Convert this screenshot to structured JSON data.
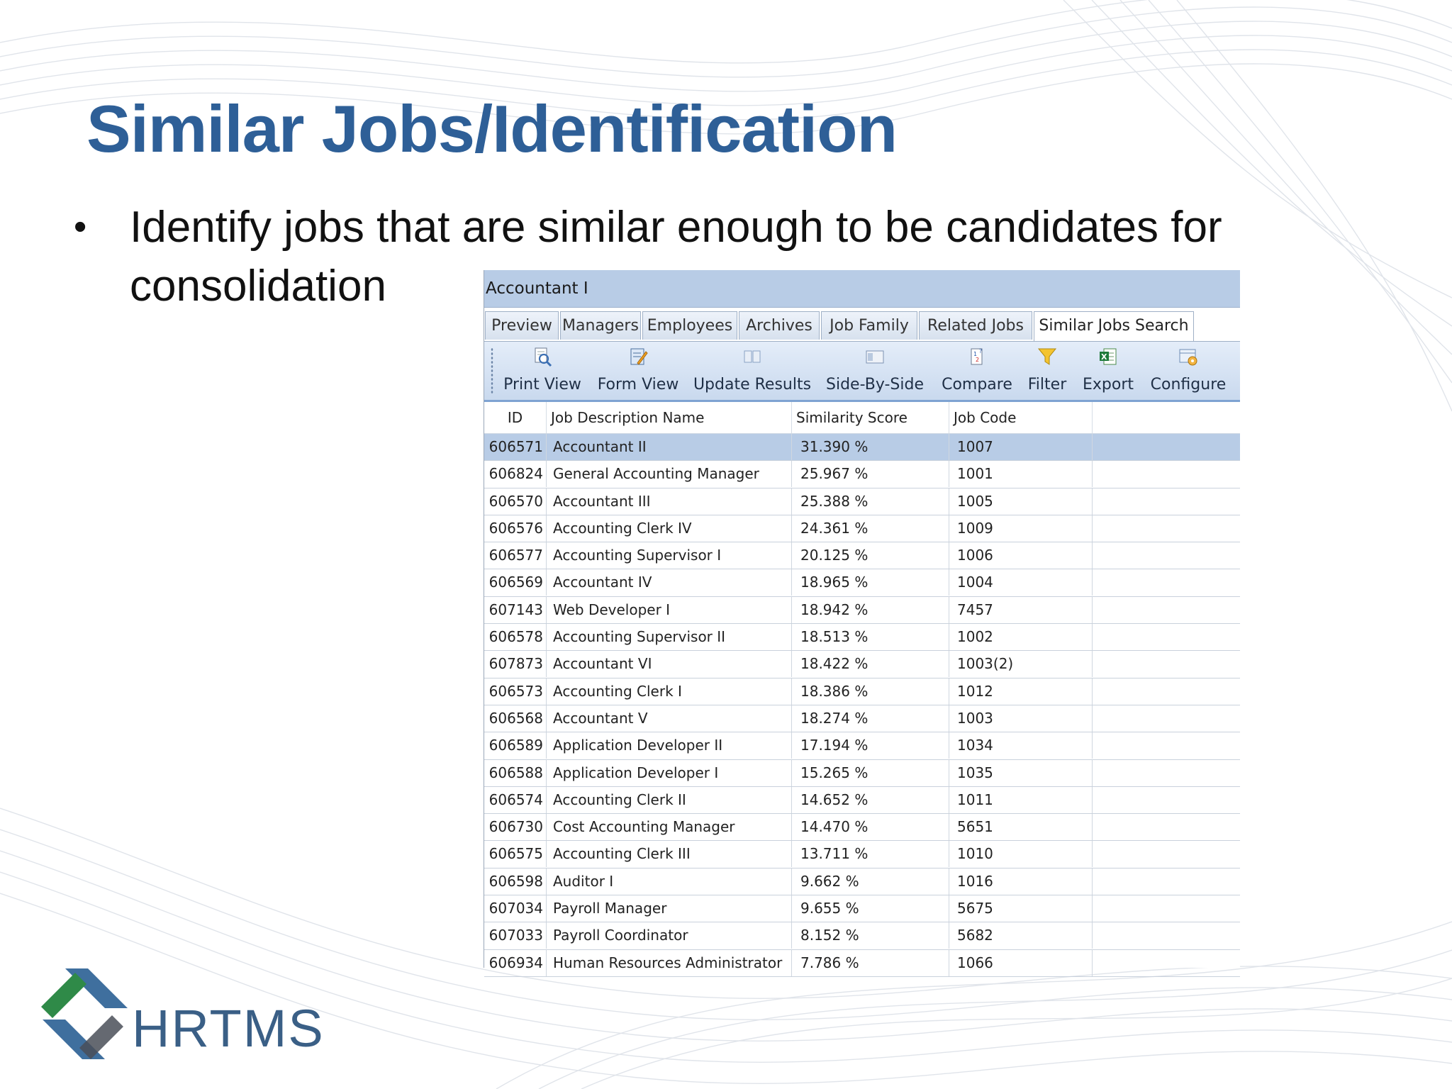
{
  "slide": {
    "title": "Similar Jobs/Identification",
    "bullet_line1": "Identify jobs that are similar enough to be candidates for",
    "bullet_line2": "consolidation",
    "logo_text": "HRTMS"
  },
  "app": {
    "header_title": "Accountant I",
    "tabs": [
      {
        "label": "Preview"
      },
      {
        "label": "Managers"
      },
      {
        "label": "Employees"
      },
      {
        "label": "Archives"
      },
      {
        "label": "Job Family"
      },
      {
        "label": "Related Jobs"
      },
      {
        "label": "Similar Jobs Search",
        "active": true
      }
    ],
    "toolbar": [
      {
        "label": "Print View",
        "icon": "print-view-icon"
      },
      {
        "label": "Form View",
        "icon": "form-view-icon"
      },
      {
        "label": "Update Results",
        "icon": "update-results-icon"
      },
      {
        "label": "Side-By-Side",
        "icon": "side-by-side-icon"
      },
      {
        "label": "Compare",
        "icon": "compare-icon"
      },
      {
        "label": "Filter",
        "icon": "filter-icon"
      },
      {
        "label": "Export",
        "icon": "excel-export-icon"
      },
      {
        "label": "Configure",
        "icon": "configure-icon"
      }
    ],
    "columns": [
      "ID",
      "Job Description Name",
      "Similarity Score",
      "Job Code"
    ],
    "rows": [
      {
        "id": "606571",
        "name": "Accountant II",
        "score": "31.390 %",
        "code": "1007",
        "selected": true
      },
      {
        "id": "606824",
        "name": "General Accounting Manager",
        "score": "25.967 %",
        "code": "1001"
      },
      {
        "id": "606570",
        "name": "Accountant III",
        "score": "25.388 %",
        "code": "1005"
      },
      {
        "id": "606576",
        "name": "Accounting Clerk IV",
        "score": "24.361 %",
        "code": "1009"
      },
      {
        "id": "606577",
        "name": "Accounting Supervisor I",
        "score": "20.125 %",
        "code": "1006"
      },
      {
        "id": "606569",
        "name": "Accountant IV",
        "score": "18.965 %",
        "code": "1004"
      },
      {
        "id": "607143",
        "name": "Web Developer I",
        "score": "18.942 %",
        "code": "7457"
      },
      {
        "id": "606578",
        "name": "Accounting Supervisor II",
        "score": "18.513 %",
        "code": "1002"
      },
      {
        "id": "607873",
        "name": "Accountant VI",
        "score": "18.422 %",
        "code": "1003(2)"
      },
      {
        "id": "606573",
        "name": "Accounting Clerk I",
        "score": "18.386 %",
        "code": "1012"
      },
      {
        "id": "606568",
        "name": "Accountant V",
        "score": "18.274 %",
        "code": "1003"
      },
      {
        "id": "606589",
        "name": "Application Developer II",
        "score": "17.194 %",
        "code": "1034"
      },
      {
        "id": "606588",
        "name": "Application Developer I",
        "score": "15.265 %",
        "code": "1035"
      },
      {
        "id": "606574",
        "name": "Accounting Clerk II",
        "score": "14.652 %",
        "code": "1011"
      },
      {
        "id": "606730",
        "name": "Cost Accounting Manager",
        "score": "14.470 %",
        "code": "5651"
      },
      {
        "id": "606575",
        "name": "Accounting Clerk III",
        "score": "13.711 %",
        "code": "1010"
      },
      {
        "id": "606598",
        "name": "Auditor I",
        "score": "9.662 %",
        "code": "1016"
      },
      {
        "id": "607034",
        "name": "Payroll Manager",
        "score": "9.655 %",
        "code": "5675"
      },
      {
        "id": "607033",
        "name": "Payroll Coordinator",
        "score": "8.152 %",
        "code": "5682"
      },
      {
        "id": "606934",
        "name": "Human Resources Administrator",
        "score": "7.786 %",
        "code": "1066"
      }
    ]
  },
  "colors": {
    "title": "#2e5f97",
    "header_bar": "#b8cce6",
    "selected_row": "#b8cce6",
    "logo": "#3a5f86"
  }
}
